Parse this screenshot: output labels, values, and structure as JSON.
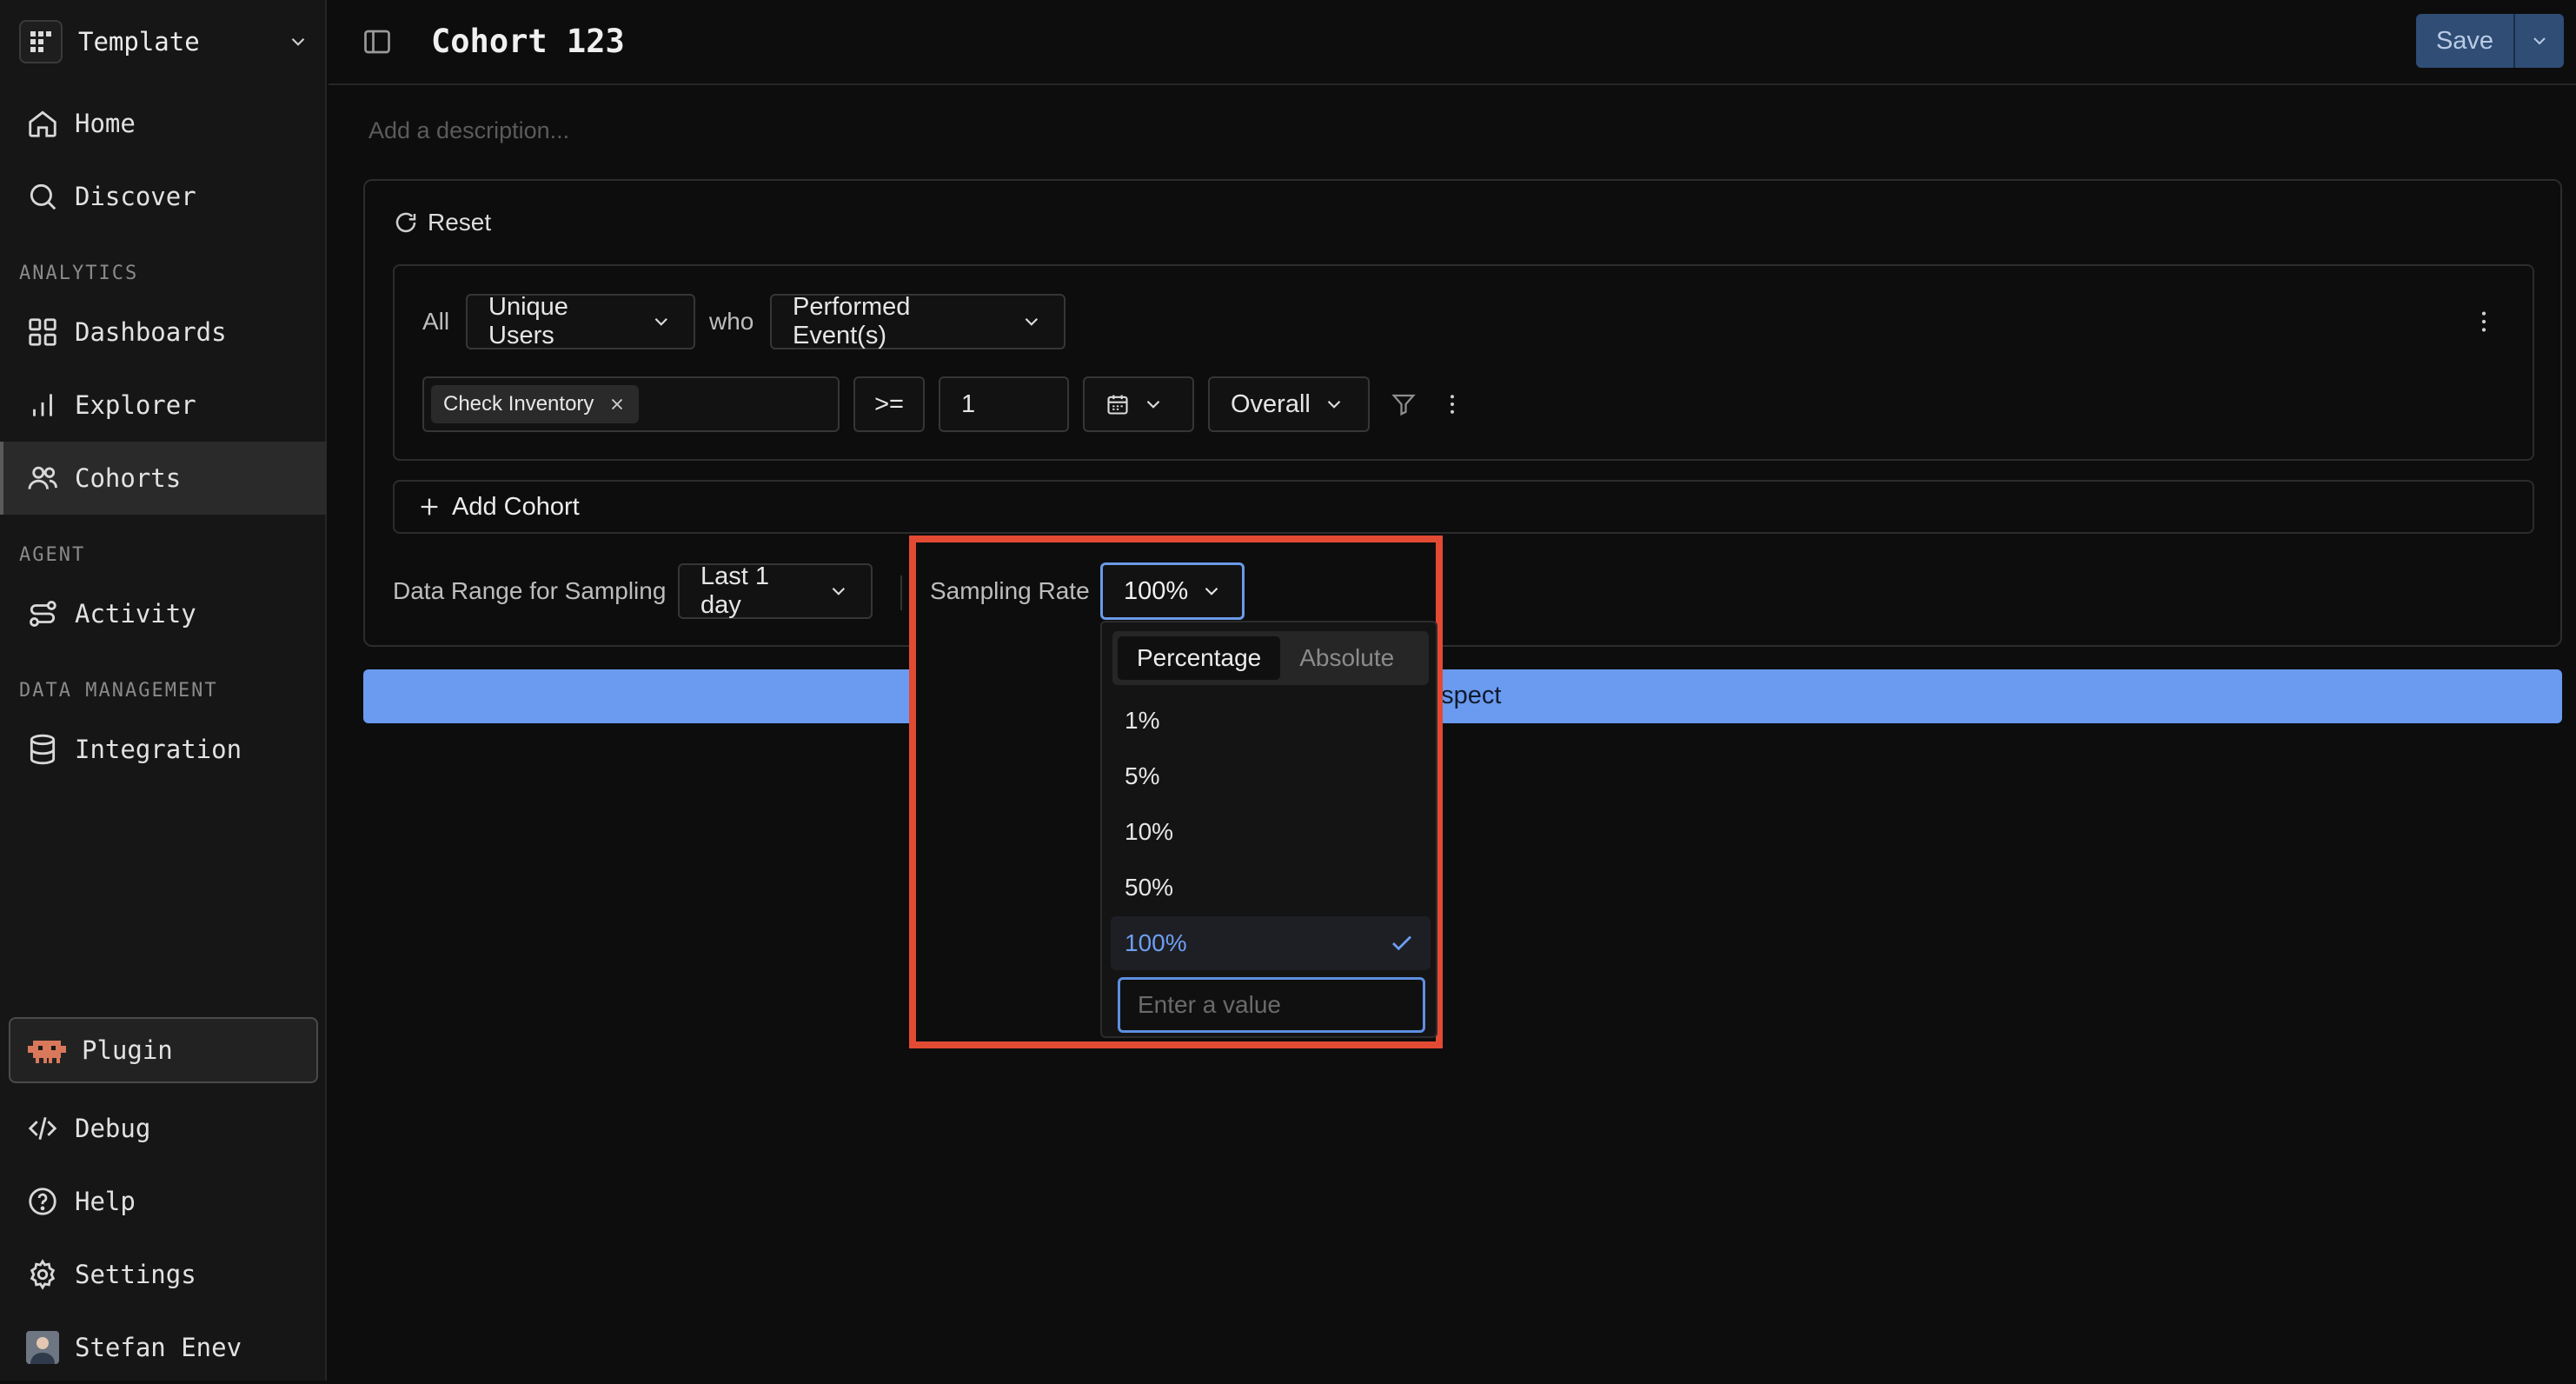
{
  "workspace": {
    "name": "Template"
  },
  "sidebar": {
    "top_items": [
      {
        "label": "Home",
        "icon": "home-icon"
      },
      {
        "label": "Discover",
        "icon": "search-icon"
      }
    ],
    "sections": [
      {
        "label": "ANALYTICS",
        "items": [
          {
            "label": "Dashboards",
            "icon": "dashboard-icon"
          },
          {
            "label": "Explorer",
            "icon": "bar-chart-icon"
          },
          {
            "label": "Cohorts",
            "icon": "users-icon",
            "active": true
          }
        ]
      },
      {
        "label": "AGENT",
        "items": [
          {
            "label": "Activity",
            "icon": "route-icon"
          }
        ]
      },
      {
        "label": "DATA MANAGEMENT",
        "items": [
          {
            "label": "Integration",
            "icon": "database-icon"
          }
        ]
      }
    ],
    "bottom_items": [
      {
        "label": "Plugin",
        "icon": "plugin-icon"
      },
      {
        "label": "Debug",
        "icon": "code-icon"
      },
      {
        "label": "Help",
        "icon": "help-icon"
      },
      {
        "label": "Settings",
        "icon": "gear-icon"
      },
      {
        "label": "Stefan Enev",
        "icon": "avatar"
      }
    ]
  },
  "header": {
    "title": "Cohort 123",
    "save_label": "Save"
  },
  "description": {
    "placeholder": "Add a description..."
  },
  "builder": {
    "reset_label": "Reset",
    "all_label": "All",
    "subject": "Unique Users",
    "who_label": "who",
    "condition": "Performed Event(s)",
    "event_chip": "Check Inventory",
    "operator": ">=",
    "threshold": "1",
    "aggregation": "Overall",
    "add_cohort_label": "Add Cohort"
  },
  "sampling": {
    "range_label": "Data Range for Sampling",
    "range_value": "Last 1 day",
    "rate_label": "Sampling Rate",
    "rate_value": "100%",
    "modes": [
      "Percentage",
      "Absolute"
    ],
    "active_mode": "Percentage",
    "options": [
      "1%",
      "5%",
      "10%",
      "50%",
      "100%"
    ],
    "selected": "100%",
    "custom_placeholder": "Enter a value"
  },
  "inspect": {
    "label": "Inspect",
    "visible_label": "nspect"
  },
  "colors": {
    "accent": "#6a9bf0",
    "highlight": "#e24a33",
    "save_bg": "#2f4d75"
  }
}
